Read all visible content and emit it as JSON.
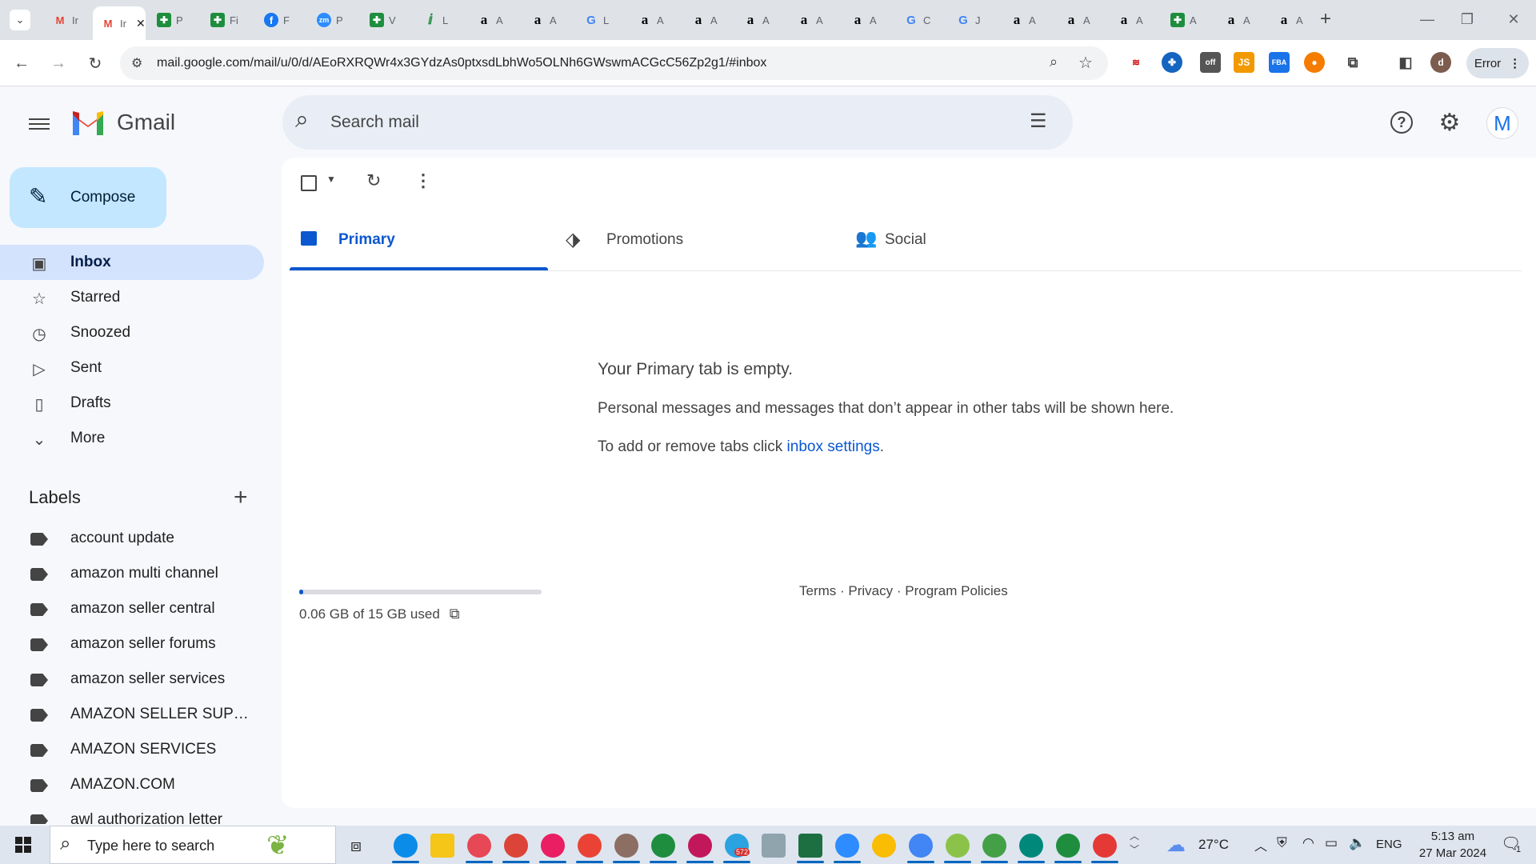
{
  "browser": {
    "tabs": [
      {
        "icon": "gmail",
        "text": "Ir"
      },
      {
        "icon": "gmail",
        "text": "Ir",
        "active": true
      },
      {
        "icon": "sheets",
        "text": "P"
      },
      {
        "icon": "sheets",
        "text": "Fi"
      },
      {
        "icon": "fb",
        "text": "F"
      },
      {
        "icon": "zm",
        "text": "P"
      },
      {
        "icon": "sheets",
        "text": "V"
      },
      {
        "icon": "ll",
        "text": "L"
      },
      {
        "icon": "amz",
        "text": "A"
      },
      {
        "icon": "amz",
        "text": "A"
      },
      {
        "icon": "goog",
        "text": "L"
      },
      {
        "icon": "amz",
        "text": "A"
      },
      {
        "icon": "amz",
        "text": "A"
      },
      {
        "icon": "amz",
        "text": "A"
      },
      {
        "icon": "amz",
        "text": "A"
      },
      {
        "icon": "amz",
        "text": "A"
      },
      {
        "icon": "goog",
        "text": "C"
      },
      {
        "icon": "goog",
        "text": "J"
      },
      {
        "icon": "amz",
        "text": "A"
      },
      {
        "icon": "amz",
        "text": "A"
      },
      {
        "icon": "amz",
        "text": "A"
      },
      {
        "icon": "sheets",
        "text": "A"
      },
      {
        "icon": "amz",
        "text": "A"
      },
      {
        "icon": "amz",
        "text": "A"
      }
    ],
    "url": "mail.google.com/mail/u/0/d/AEoRXRQWr4x3GYdzAs0ptxsdLbhWo5OLNh6GWswmACGcC56Zp2g1/#inbox",
    "error_label": "Error",
    "profile_initial": "d"
  },
  "gmail": {
    "logo_text": "Gmail",
    "search_placeholder": "Search mail",
    "compose_label": "Compose",
    "avatar_initial": "M",
    "nav": [
      {
        "label": "Inbox",
        "icon": "inbox-icon",
        "glyph": "▣",
        "active": true
      },
      {
        "label": "Starred",
        "icon": "star-icon",
        "glyph": "☆"
      },
      {
        "label": "Snoozed",
        "icon": "clock-icon",
        "glyph": "◷"
      },
      {
        "label": "Sent",
        "icon": "send-icon",
        "glyph": "▷"
      },
      {
        "label": "Drafts",
        "icon": "draft-icon",
        "glyph": "▯"
      },
      {
        "label": "More",
        "icon": "chevron-down-icon",
        "glyph": "⌄"
      }
    ],
    "labels_title": "Labels",
    "labels": [
      "account update",
      "amazon multi channel",
      "amazon seller central",
      "amazon seller forums",
      "amazon seller services",
      "AMAZON SELLER SUPP...",
      "AMAZON SERVICES",
      "AMAZON.COM",
      "awl authorization letter"
    ],
    "tabs": {
      "primary": "Primary",
      "promotions": "Promotions",
      "social": "Social"
    },
    "empty": {
      "title": "Your Primary tab is empty.",
      "description": "Personal messages and messages that don’t appear in other tabs will be shown here.",
      "help_prefix": "To add or remove tabs click ",
      "help_link": "inbox settings",
      "help_suffix": "."
    },
    "storage": {
      "text": "0.06 GB of 15 GB used",
      "used_fraction": 0.004
    },
    "footer": {
      "terms": "Terms",
      "privacy": "Privacy",
      "policies": "Program Policies",
      "sep": " · "
    }
  },
  "taskbar": {
    "search_placeholder": "Type here to search",
    "weather": "27°C",
    "language": "ENG",
    "time": "5:13 am",
    "date": "27 Mar 2024",
    "telegram_badge": "572",
    "notification_count": "1"
  }
}
